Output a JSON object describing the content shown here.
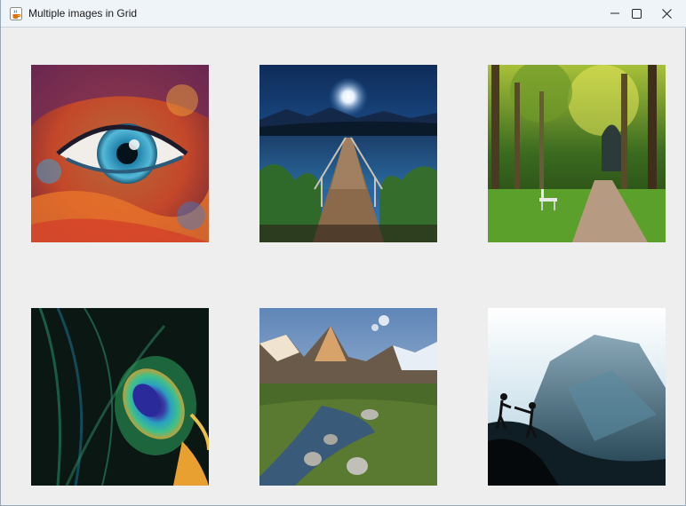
{
  "window": {
    "title": "Multiple images in Grid",
    "icon": "java-cup-icon",
    "controls": {
      "minimize": "minimize-icon",
      "maximize": "maximize-icon",
      "close": "close-icon"
    }
  },
  "grid": {
    "rows": 2,
    "columns": 3,
    "images": [
      {
        "subject": "colorful-eye",
        "row": 1,
        "col": 1
      },
      {
        "subject": "lake-pier-moon",
        "row": 1,
        "col": 2
      },
      {
        "subject": "forest-path-bench",
        "row": 1,
        "col": 3
      },
      {
        "subject": "peacock-feather",
        "row": 2,
        "col": 1
      },
      {
        "subject": "mountain-stream",
        "row": 2,
        "col": 2
      },
      {
        "subject": "climbers-mountain",
        "row": 2,
        "col": 3
      }
    ]
  }
}
